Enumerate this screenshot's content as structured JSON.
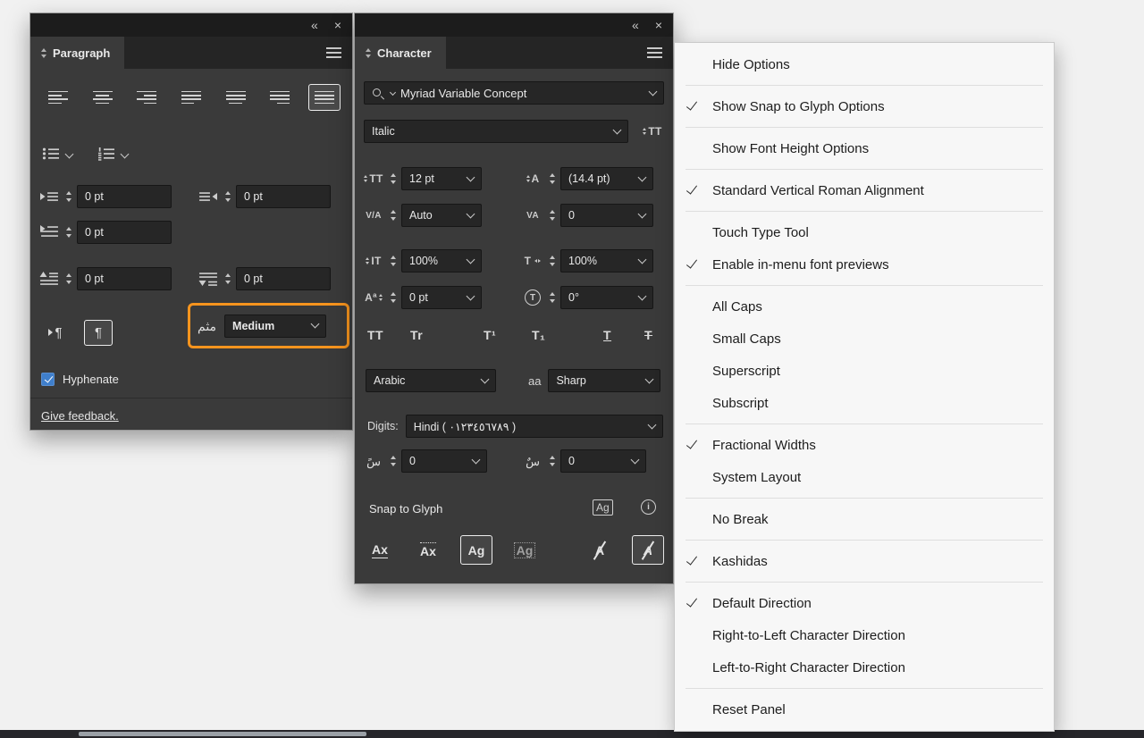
{
  "colors": {
    "accent_orange": "#F7941E",
    "checkbox_blue": "#3F7FCC",
    "panel_background": "#3A3A3A",
    "menu_background": "#F7F7F7"
  },
  "glyphs": {
    "collapse_panel": "«",
    "close": "×",
    "pilcrow": "¶",
    "tt_caps": "TT",
    "tr_smallcaps": "Tr",
    "t_superscript": "T¹",
    "t_subscript": "T₁",
    "t_underline": "T",
    "t_strikethrough": "T",
    "size_icon": "TT",
    "leading_icon": "A",
    "kerning_icon": "V/A",
    "tracking_icon": "VA",
    "vscale_icon": "IT",
    "hscale_icon": "T",
    "baseline_icon": "Aª",
    "rotation_icon": "T",
    "font_height_icon": "TT",
    "aa_icon": "aa",
    "justification_icon": "مثم",
    "kashida_before_icon": "سً",
    "kashida_after_icon": "سٌ",
    "ag_badge": "Ag",
    "info": "i",
    "snap_baseline": "Ax",
    "snap_xheight": "Ax",
    "snap_glyph_bounds": "Ag",
    "snap_glyph_bounds2": "Ag",
    "snap_angle": "A",
    "snap_italic": "A"
  },
  "paragraph_panel": {
    "tab": "Paragraph",
    "alignment_buttons": [
      {
        "name": "align-left",
        "selected": false
      },
      {
        "name": "align-center",
        "selected": false
      },
      {
        "name": "align-right",
        "selected": false
      },
      {
        "name": "justify-last-left",
        "selected": false
      },
      {
        "name": "justify-last-center",
        "selected": false
      },
      {
        "name": "justify-last-right",
        "selected": false
      },
      {
        "name": "justify-all",
        "selected": true
      }
    ],
    "fields": {
      "left_indent": "0 pt",
      "right_indent": "0 pt",
      "first_line_indent": "0 pt",
      "space_before": "0 pt",
      "space_after": "0 pt"
    },
    "composer_dropdown": {
      "value": "Medium"
    },
    "hyphenate": {
      "label": "Hyphenate",
      "checked": true
    },
    "feedback_link": "Give feedback."
  },
  "character_panel": {
    "tab": "Character",
    "font_family": "Myriad Variable Concept",
    "font_style": "Italic",
    "size": "12 pt",
    "leading": "(14.4 pt)",
    "kerning": "Auto",
    "tracking": "0",
    "vertical_scale": "100%",
    "horizontal_scale": "100%",
    "baseline_shift": "0 pt",
    "character_rotation": "0°",
    "language": "Arabic",
    "anti_aliasing": "Sharp",
    "digits_label": "Digits:",
    "digits": "Hindi ( ٠١٢٣٤٥٦٧٨٩ )",
    "kashida_before": "0",
    "kashida_after": "0",
    "snap_to_glyph_label": "Snap to Glyph"
  },
  "menu": {
    "groups": [
      [
        {
          "label": "Hide Options",
          "checked": false
        }
      ],
      [
        {
          "label": "Show Snap to Glyph Options",
          "checked": true
        }
      ],
      [
        {
          "label": "Show Font Height Options",
          "checked": false
        }
      ],
      [
        {
          "label": "Standard Vertical Roman Alignment",
          "checked": true
        }
      ],
      [
        {
          "label": "Touch Type Tool",
          "checked": false
        },
        {
          "label": "Enable in-menu font previews",
          "checked": true
        }
      ],
      [
        {
          "label": "All Caps",
          "checked": false
        },
        {
          "label": "Small Caps",
          "checked": false
        },
        {
          "label": "Superscript",
          "checked": false
        },
        {
          "label": "Subscript",
          "checked": false
        }
      ],
      [
        {
          "label": "Fractional Widths",
          "checked": true
        },
        {
          "label": "System Layout",
          "checked": false
        }
      ],
      [
        {
          "label": "No Break",
          "checked": false
        }
      ],
      [
        {
          "label": "Kashidas",
          "checked": true
        }
      ],
      [
        {
          "label": "Default Direction",
          "checked": true
        },
        {
          "label": "Right-to-Left Character Direction",
          "checked": false
        },
        {
          "label": "Left-to-Right Character Direction",
          "checked": false
        }
      ],
      [
        {
          "label": "Reset Panel",
          "checked": false
        }
      ]
    ]
  }
}
